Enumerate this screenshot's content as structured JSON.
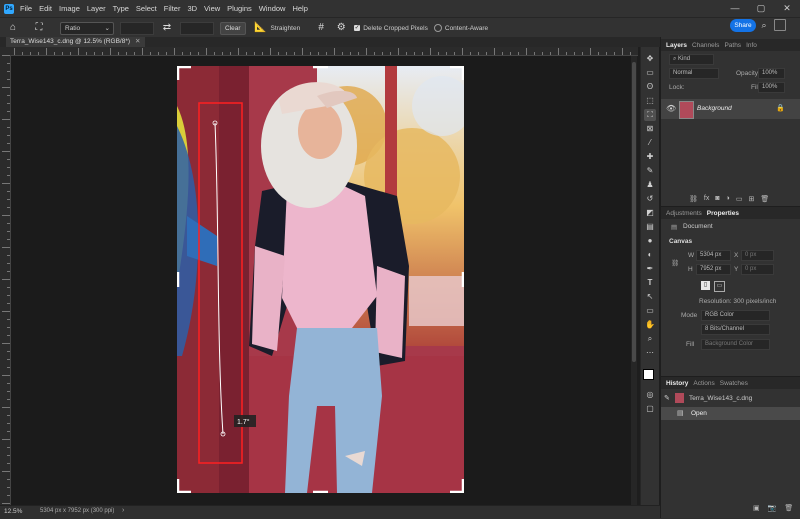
{
  "menu": [
    "File",
    "Edit",
    "Image",
    "Layer",
    "Type",
    "Select",
    "Filter",
    "3D",
    "View",
    "Plugins",
    "Window",
    "Help"
  ],
  "app_logo": "Ps",
  "window_controls": {
    "minimize": "—",
    "maximize": "▢",
    "close": "✕"
  },
  "options_bar": {
    "ratio_label": "Ratio",
    "clear_label": "Clear",
    "straighten_label": "Straighten",
    "delete_cropped_label": "Delete Cropped Pixels",
    "content_aware_label": "Content-Aware",
    "share_label": "Share"
  },
  "document": {
    "tab_title": "Terra_Wise143_c.dng @ 12.5% (RGB/8*)",
    "straighten_angle": "1.7°"
  },
  "status": {
    "zoom": "12.5%",
    "doc_info": "5304 px x 7952 px (300 ppi)"
  },
  "layers_panel": {
    "tabs": [
      "Layers",
      "Channels",
      "Paths",
      "Info"
    ],
    "search_placeholder": "Kind",
    "blend_mode": "Normal",
    "opacity_label": "Opacity:",
    "opacity_value": "100%",
    "lock_label": "Lock:",
    "fill_label": "Fill:",
    "fill_value": "100%",
    "layer_name": "Background"
  },
  "properties_panel": {
    "tabs": [
      "Adjustments",
      "Properties"
    ],
    "doc_label": "Document",
    "canvas_header": "Canvas",
    "w_label": "W",
    "w_value": "5304 px",
    "x_label": "X",
    "x_value": "0 px",
    "h_label": "H",
    "h_value": "7952 px",
    "y_label": "Y",
    "y_value": "0 px",
    "resolution": "Resolution: 300 pixels/inch",
    "mode_label": "Mode",
    "mode_value": "RGB Color",
    "depth_value": "8 Bits/Channel",
    "fill_label": "Fill",
    "fill_value": "Background Color"
  },
  "history_panel": {
    "tabs": [
      "History",
      "Actions",
      "Swatches"
    ],
    "snapshot_name": "Terra_Wise143_c.dng",
    "state_name": "Open"
  },
  "colors": {
    "accent": "#1473e6",
    "panel": "#323232",
    "canvas": "#1b1b1b",
    "selection": "#ff2a2a"
  }
}
